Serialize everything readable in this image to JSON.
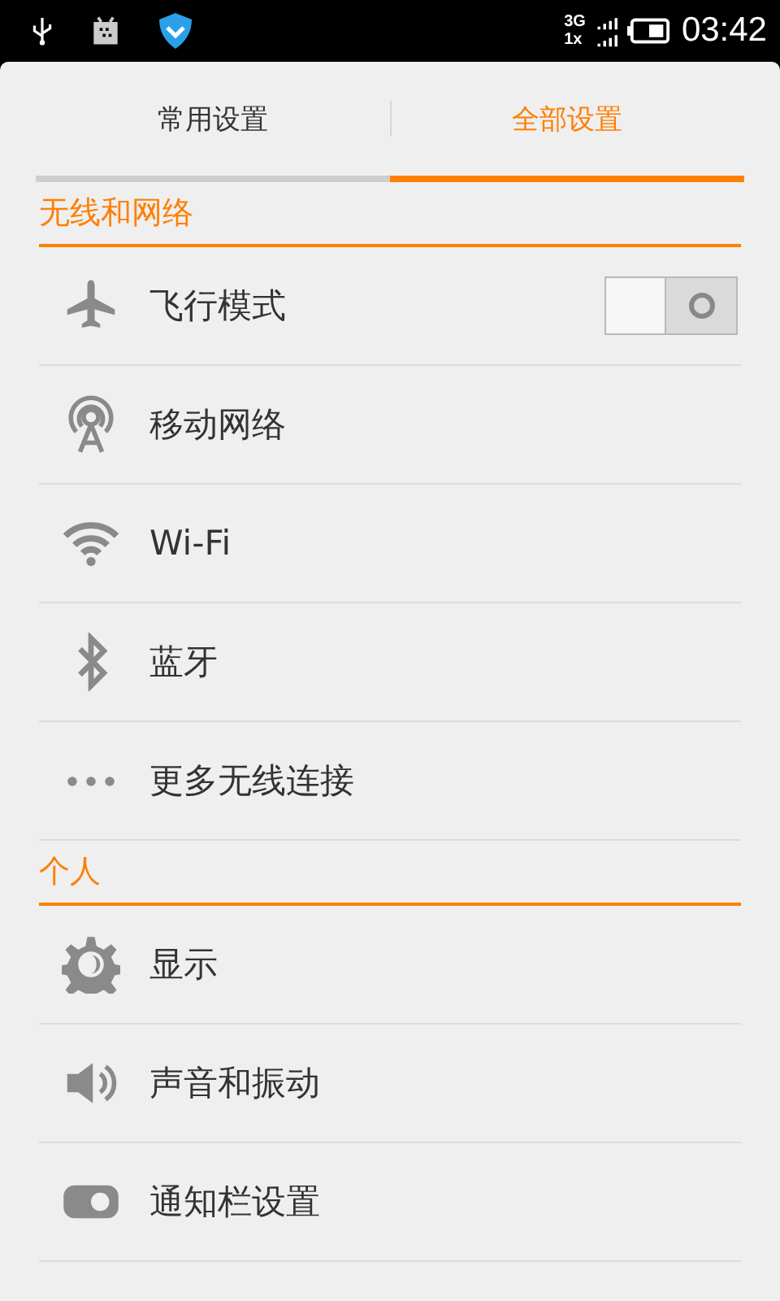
{
  "status_bar": {
    "network_top": "3G",
    "network_bottom": "1x",
    "time": "03:42"
  },
  "tabs": [
    {
      "label": "常用设置",
      "selected": false
    },
    {
      "label": "全部设置",
      "selected": true
    }
  ],
  "sections": [
    {
      "title": "无线和网络",
      "items": [
        {
          "kind": "toggle",
          "label": "飞行模式",
          "on": false
        },
        {
          "kind": "link",
          "label": "移动网络"
        },
        {
          "kind": "link",
          "label": "Wi-Fi"
        },
        {
          "kind": "link",
          "label": "蓝牙"
        },
        {
          "kind": "link",
          "label": "更多无线连接"
        }
      ]
    },
    {
      "title": "个人",
      "items": [
        {
          "kind": "link",
          "label": "显示"
        },
        {
          "kind": "link",
          "label": "声音和振动"
        },
        {
          "kind": "link",
          "label": "通知栏设置"
        }
      ]
    }
  ]
}
